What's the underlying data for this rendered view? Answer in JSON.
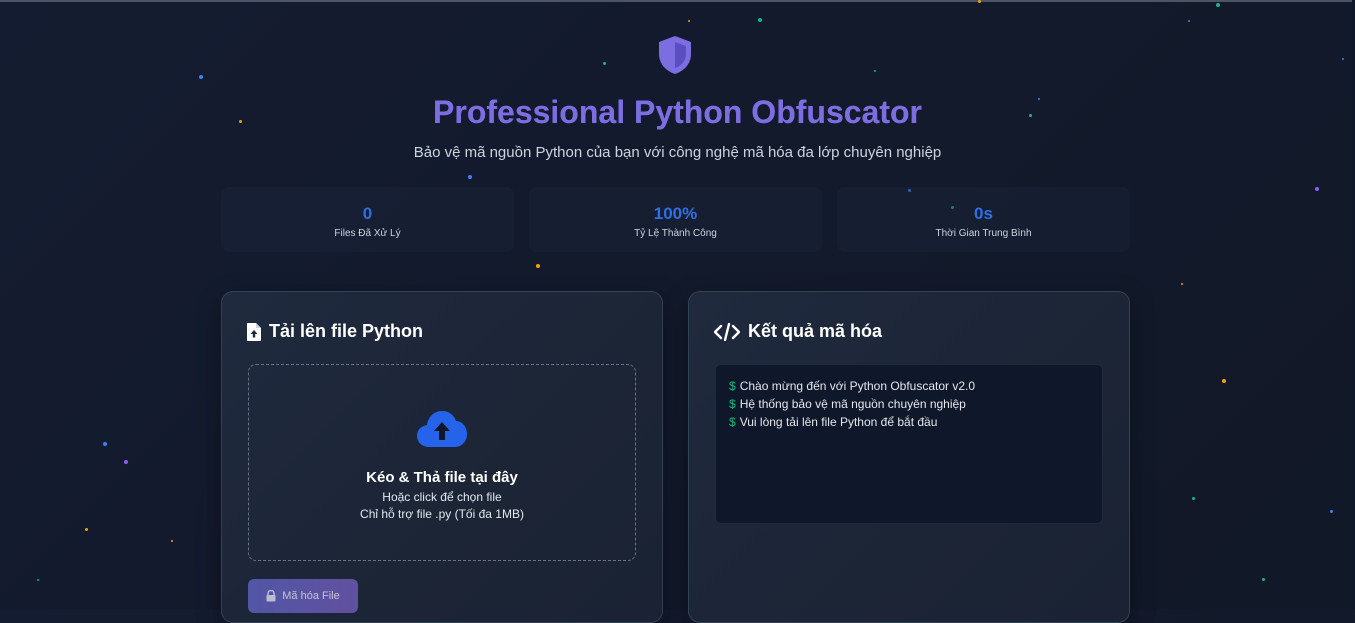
{
  "header": {
    "title": "Professional Python Obfuscator",
    "subtitle": "Bảo vệ mã nguồn Python của bạn với công nghệ mã hóa đa lớp chuyên nghiệp"
  },
  "stats": [
    {
      "value": "0",
      "label": "Files Đã Xử Lý"
    },
    {
      "value": "100%",
      "label": "Tỷ Lệ Thành Công"
    },
    {
      "value": "0s",
      "label": "Thời Gian Trung Bình"
    }
  ],
  "upload": {
    "title": "Tải lên file Python",
    "drop_title": "Kéo & Thả file tại đây",
    "drop_line1": "Hoặc click để chọn file",
    "drop_line2": "Chỉ hỗ trợ file .py (Tối đa 1MB)",
    "button_label": "Mã hóa File"
  },
  "result": {
    "title": "Kết quả mã hóa",
    "prompt": "$",
    "lines": [
      "Chào mừng đến với Python Obfuscator v2.0",
      "Hệ thống bảo vệ mã nguồn chuyên nghiệp",
      "Vui lòng tải lên file Python để bắt đầu"
    ]
  },
  "icons": {
    "shield": "shield-icon",
    "file_upload": "file-upload-icon",
    "code": "code-icon",
    "cloud_upload": "cloud-upload-icon",
    "lock": "lock-icon"
  },
  "colors": {
    "accent": "#6366f1",
    "accent_secondary": "#8b5cf6",
    "stat_value": "#2f6fe6",
    "terminal_prompt": "#10b981",
    "background": "#131a2c"
  }
}
